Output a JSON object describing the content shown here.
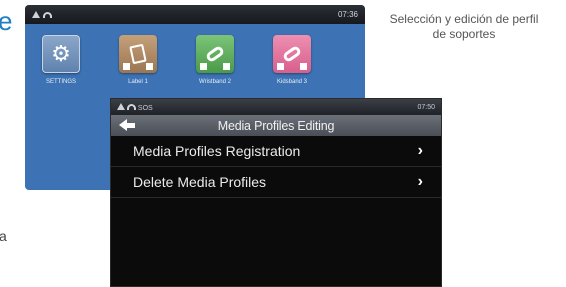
{
  "caption": "Selección y edición de perfil de soportes",
  "edge_fragments": {
    "top": "e",
    "bottom": "a"
  },
  "launcher": {
    "time": "07:36",
    "apps": [
      {
        "label": "SETTINGS",
        "icon": "gear-icon"
      },
      {
        "label": "Label 1",
        "icon": "label-icon"
      },
      {
        "label": "Wristband 2",
        "icon": "wristband-icon"
      },
      {
        "label": "Kidsband 3",
        "icon": "kidsband-icon"
      }
    ]
  },
  "editor": {
    "status_text": "SOS",
    "time": "07:50",
    "title": "Media Profiles Editing",
    "menu": [
      {
        "label": "Media Profiles Registration",
        "chevron": "›"
      },
      {
        "label": "Delete Media Profiles",
        "chevron": "›"
      }
    ]
  }
}
